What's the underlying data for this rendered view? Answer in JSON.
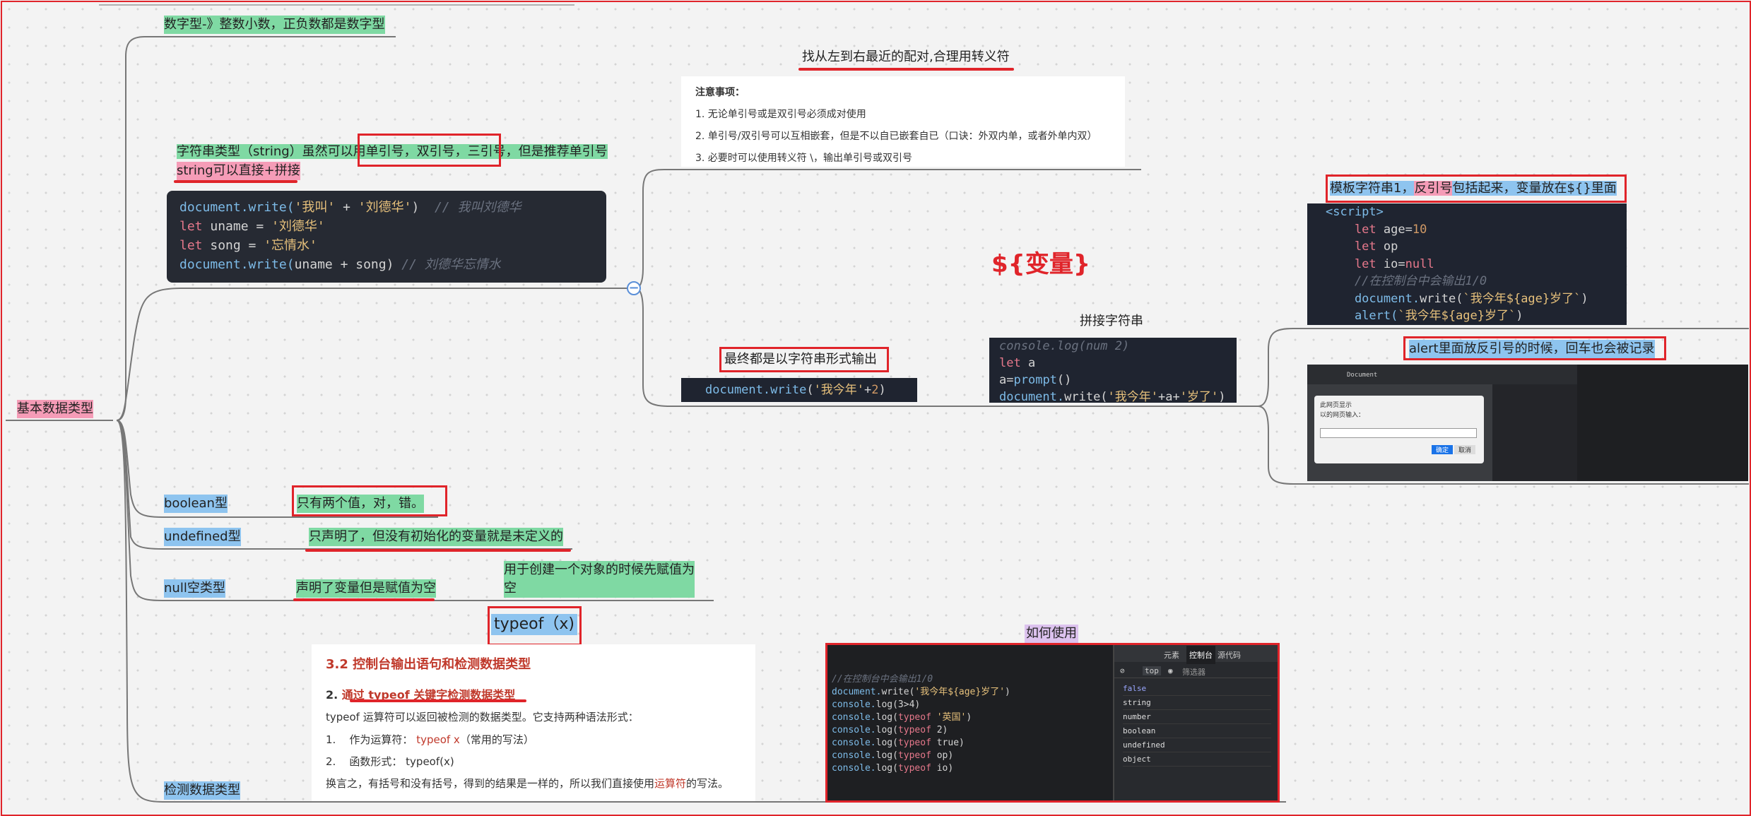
{
  "root": {
    "label": "基本数据类型"
  },
  "nodes": {
    "number_type": "数字型-》整数小数，正负数都是数字型",
    "string_type_a": "字符串类型（string）虽然可以用",
    "string_type_b": "单引号，双引号，三引号",
    "string_type_c": "，但是推荐单引号",
    "string_concat": "string可以直接+拼接",
    "boolean_type": "boolean型",
    "boolean_desc": "只有两个值，对，错。",
    "undefined_type": "undefined型",
    "undefined_desc": "只声明了，但没有初始化的变量就是未定义的",
    "null_type": "null空类型",
    "null_desc": "声明了变量但是赋值为空",
    "null_note_1": "用于创建一个对象的时候先赋值为",
    "null_note_2": "空",
    "typeof_label": "typeof（x)",
    "detect_type": "检测数据类型",
    "nearest_pair": "找从左到右最近的配对,合理用转义符",
    "output_string": "最终都是以字符串形式输出",
    "template_var": "${变量}",
    "concat_string": "拼接字符串",
    "template_string_a": "模板字符串1，",
    "template_string_b": "反引号",
    "template_string_c": "包括起来，",
    "template_string_d": "变量放在${}里面",
    "alert_backtick": "alert里面放反引号的时候，回车也会被记录",
    "how_to_use": "如何使用"
  },
  "notes": {
    "title": "注意事项：",
    "items": [
      "1. 无论单引号或是双引号必须成对使用",
      "2. 单引号/双引号可以互相嵌套，但是不以自已嵌套自已（口诀：外双内单，或者外单内双）",
      "3. 必要时可以使用转义符 \\，输出单引号或双引号"
    ]
  },
  "code_string": [
    [
      [
        "document.write(",
        "fn"
      ],
      [
        "'我叫'",
        "str"
      ],
      [
        " + ",
        ""
      ],
      [
        "'刘德华'",
        "str"
      ],
      [
        ")  ",
        ""
      ],
      [
        "// 我叫刘德华",
        "cm"
      ]
    ],
    [
      [
        "let ",
        "kw"
      ],
      [
        "uname = ",
        ""
      ],
      [
        "'刘德华'",
        "str"
      ]
    ],
    [
      [
        "let ",
        "kw"
      ],
      [
        "song = ",
        ""
      ],
      [
        "'忘情水'",
        "str"
      ]
    ],
    [
      [
        "document.write(",
        "fn"
      ],
      [
        "uname + song) ",
        ""
      ],
      [
        "// 刘德华忘情水",
        "cm"
      ]
    ]
  ],
  "code_output": [
    [
      [
        "document.",
        "fn"
      ],
      [
        "write",
        "fn"
      ],
      [
        "(",
        ""
      ],
      [
        "'我今年'",
        "str"
      ],
      [
        "+",
        ""
      ],
      [
        "2",
        "num"
      ],
      [
        ")",
        ""
      ]
    ]
  ],
  "code_concat": [
    [
      [
        "console.log(num 2)",
        "cm"
      ]
    ],
    [
      [
        "let ",
        "kw"
      ],
      [
        "a",
        ""
      ]
    ],
    [
      [
        "a",
        ""
      ],
      [
        "=",
        ""
      ],
      [
        "prompt",
        "fn"
      ],
      [
        "()",
        ""
      ]
    ],
    [
      [
        "document.",
        "fn"
      ],
      [
        "write(",
        ""
      ],
      [
        "'我今年'",
        "str"
      ],
      [
        "+a+",
        ""
      ],
      [
        "'岁了'",
        "str"
      ],
      [
        ")",
        ""
      ]
    ]
  ],
  "code_template": [
    [
      [
        "<script>",
        "fn"
      ]
    ],
    [
      [
        "    let ",
        "kw"
      ],
      [
        "age",
        ""
      ],
      [
        "=",
        ""
      ],
      [
        "10",
        "num"
      ]
    ],
    [
      [
        "    let ",
        "kw"
      ],
      [
        "op",
        ""
      ]
    ],
    [
      [
        "    let ",
        "kw"
      ],
      [
        "io",
        ""
      ],
      [
        "=",
        ""
      ],
      [
        "null",
        "kw"
      ]
    ],
    [
      [
        "    //在控制台中会输出1/0",
        "cm"
      ]
    ],
    [
      [
        "    document.",
        "fn"
      ],
      [
        "write(",
        ""
      ],
      [
        "`我今年${age}岁了`",
        "str"
      ],
      [
        ")",
        ""
      ]
    ],
    [
      [
        "    alert(",
        "fn"
      ],
      [
        "`我今年${age}岁了`",
        "str"
      ],
      [
        ")",
        ""
      ]
    ]
  ],
  "typeof_doc": {
    "heading": "3.2 控制台输出语句和检测数据类型",
    "sub_prefix": "2. ",
    "sub": "通过 typeof 关键字检测数据类型",
    "desc": "typeof 运算符可以返回被检测的数据类型。它支持两种语法形式：",
    "item1_num": "1.",
    "item1_text": "作为运算符：",
    "item1_code": "typeof x",
    "item1_note": "（常用的写法）",
    "item2_num": "2.",
    "item2_text": "函数形式： typeof(x)",
    "conclusion_a": "换言之，有括号和没有括号，得到的结果是一样的，所以我们直接使用",
    "conclusion_b": "运算符",
    "conclusion_c": "的写法。"
  },
  "code_console": [
    [
      [
        "//在控制台中会输出1/0",
        "cm"
      ]
    ],
    [
      [
        "document.",
        "fn"
      ],
      [
        "write(",
        ""
      ],
      [
        "'我今年${age}岁了'",
        "str"
      ],
      [
        ")",
        ""
      ]
    ],
    [
      [
        "console.",
        "fn"
      ],
      [
        "log(3>4)",
        ""
      ]
    ],
    [
      [
        "console.",
        "fn"
      ],
      [
        "log(",
        ""
      ],
      [
        "typeof ",
        "kw"
      ],
      [
        "'英国'",
        "str"
      ],
      [
        ")",
        ""
      ]
    ],
    [
      [
        "console.",
        "fn"
      ],
      [
        "log(",
        ""
      ],
      [
        "typeof ",
        "kw"
      ],
      [
        "2)",
        ""
      ]
    ],
    [
      [
        "console.",
        "fn"
      ],
      [
        "log(",
        ""
      ],
      [
        "typeof ",
        "kw"
      ],
      [
        "true)",
        ""
      ]
    ],
    [
      [
        "console.",
        "fn"
      ],
      [
        "log(",
        ""
      ],
      [
        "typeof ",
        "kw"
      ],
      [
        "op)",
        ""
      ]
    ],
    [
      [
        "console.",
        "fn"
      ],
      [
        "log(",
        ""
      ],
      [
        "typeof ",
        "kw"
      ],
      [
        "io)",
        ""
      ]
    ]
  ],
  "devtools": {
    "tabs": [
      "元素",
      "控制台",
      "源代码"
    ],
    "context": "top",
    "filter_placeholder": "筛选器",
    "output": [
      "false",
      "string",
      "number",
      "boolean",
      "undefined",
      "object"
    ]
  },
  "browser_shot": {
    "tab_title": "Document",
    "dialog_title": "此网页显示",
    "dialog_prompt": "以的网页输入：",
    "ok": "确定",
    "cancel": "取消"
  },
  "colors": {
    "red": "#e0242a",
    "green": "#7fd9a3",
    "blue": "#8ec4ef",
    "pink": "#f59cb7",
    "branch": "#777777"
  }
}
